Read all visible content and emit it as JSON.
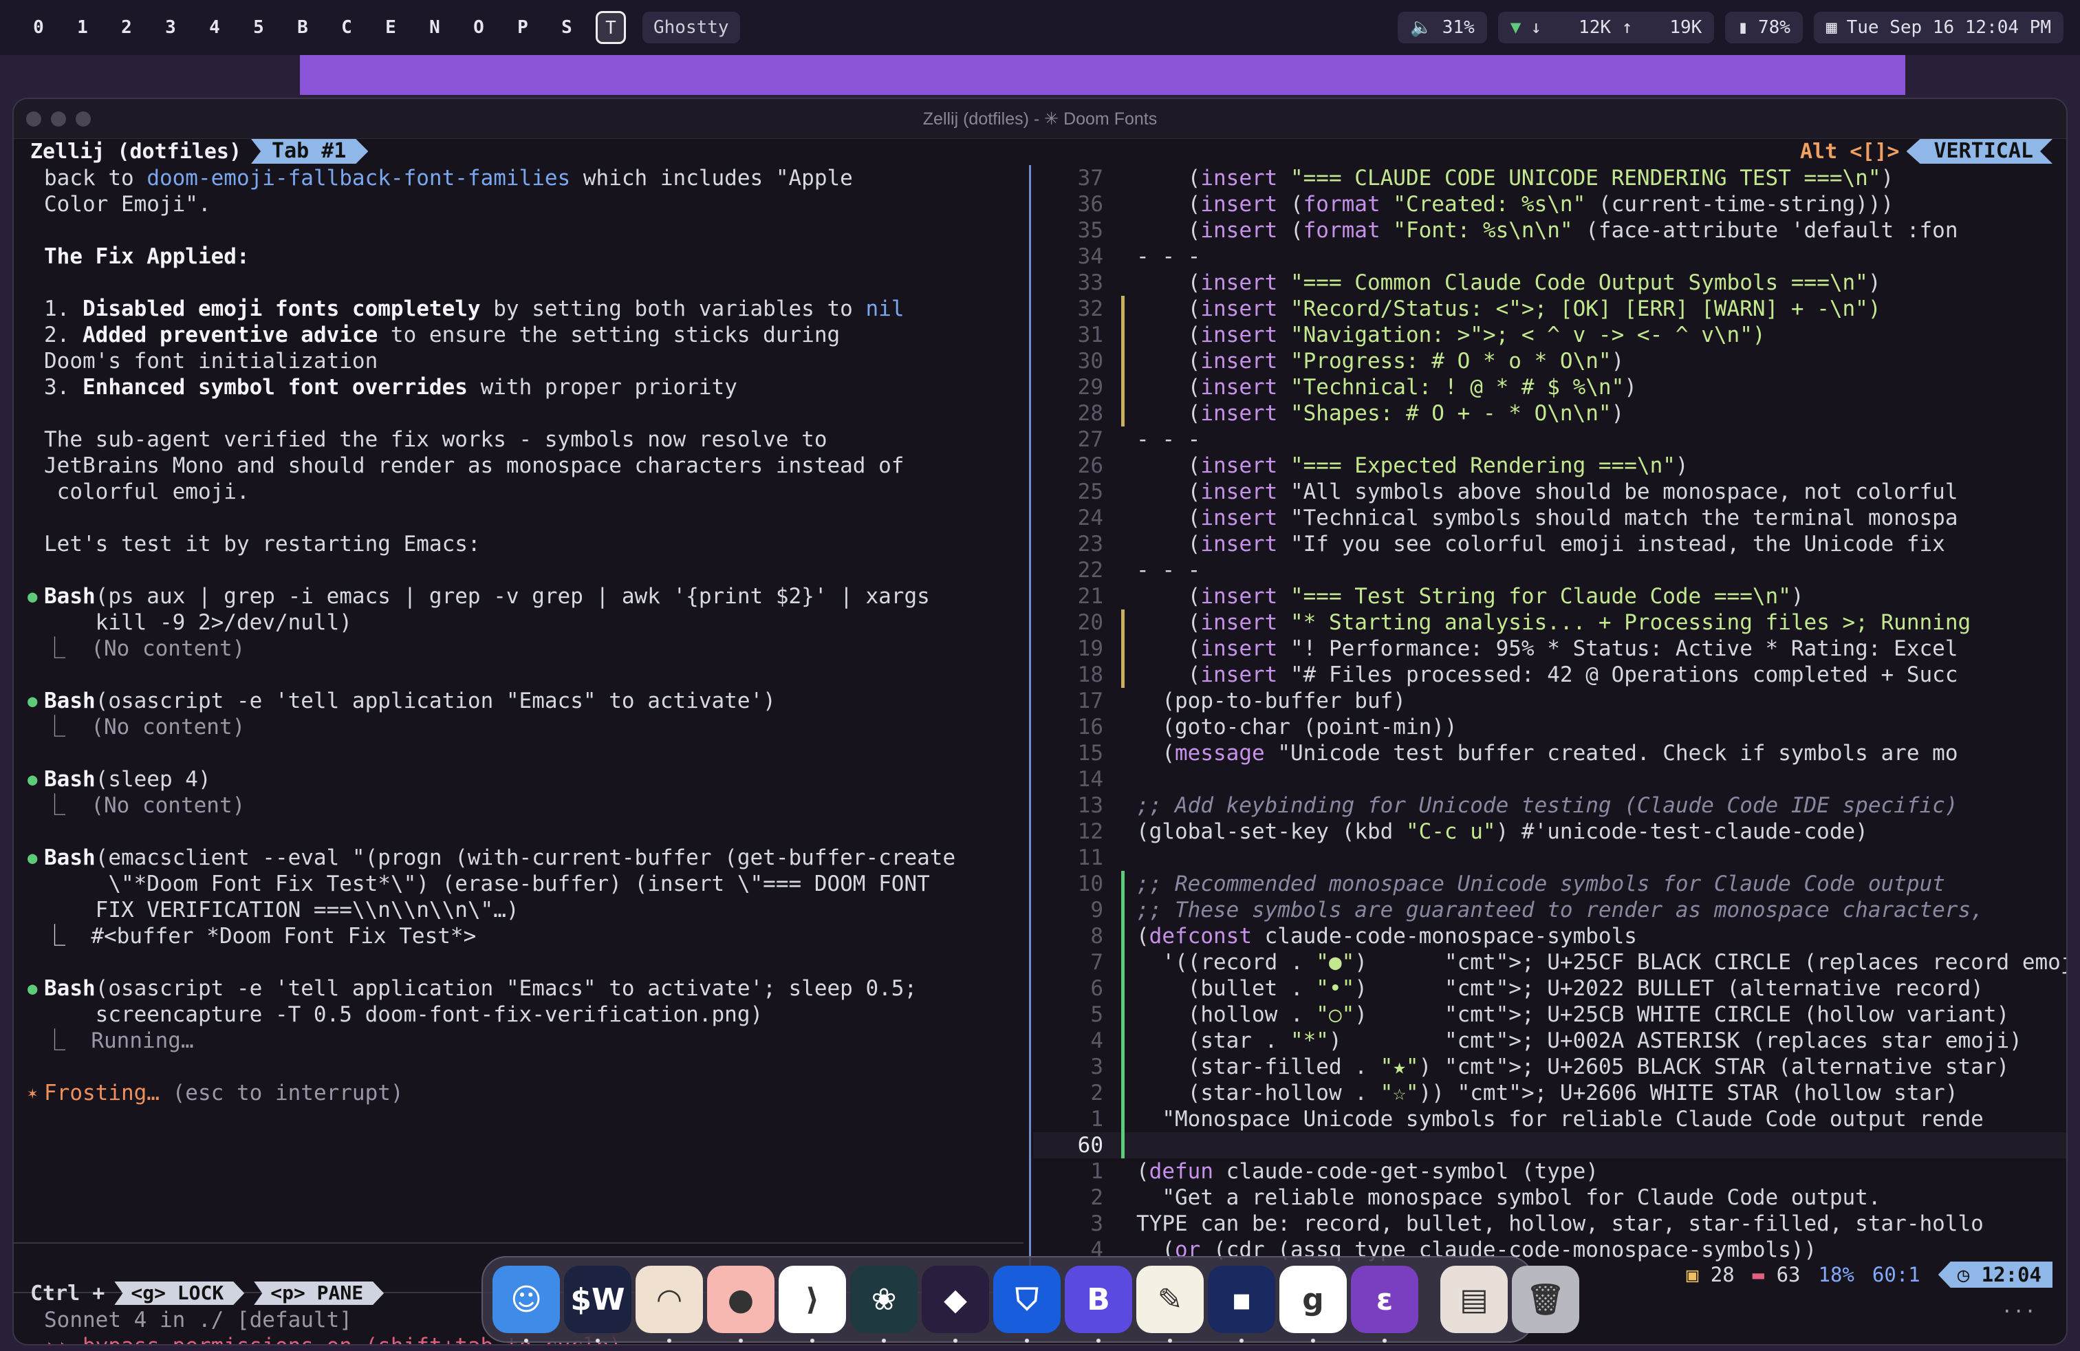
{
  "topbar": {
    "workspaces": [
      "0",
      "1",
      "2",
      "3",
      "4",
      "5",
      "B",
      "C",
      "E",
      "N",
      "O",
      "P",
      "S"
    ],
    "active_workspace": "T",
    "app": "Ghostty",
    "volume": "31%",
    "down_arrow": "↓",
    "down_speed": "12K ↑",
    "up_speed": "19K",
    "battery": "78%",
    "datetime": "Tue Sep 16 12:04 PM"
  },
  "window": {
    "title": "Zellij (dotfiles) - ✳ Doom Fonts"
  },
  "zellij": {
    "session": "Zellij (dotfiles)",
    "tab": "Tab #1",
    "mode_hint": "Alt <[]>",
    "layout": "VERTICAL",
    "bottom_prefix": "Ctrl +",
    "bottom_keys": [
      "<g> LOCK",
      "<p> PANE"
    ]
  },
  "left_pane": {
    "lines": [
      {
        "t": "back to ",
        "h": "doom-emoji-fallback-font-families",
        "r": " which includes \"Apple"
      },
      {
        "t": "Color Emoji\"."
      },
      {
        "t": ""
      },
      {
        "b": "The Fix Applied:"
      },
      {
        "t": ""
      },
      {
        "t": "1. ",
        "b2": "Disabled emoji fonts completely",
        "r": " by setting both variables to ",
        "h2": "nil"
      },
      {
        "t": "2. ",
        "b2": "Added preventive advice",
        "r": " to ensure the setting sticks during"
      },
      {
        "t": "Doom's font initialization"
      },
      {
        "t": "3. ",
        "b2": "Enhanced symbol font overrides",
        "r": " with proper priority"
      },
      {
        "t": ""
      },
      {
        "t": "The sub-agent verified the fix works - symbols now resolve to"
      },
      {
        "t": "JetBrains Mono and should render as monospace characters instead of"
      },
      {
        "t": " colorful emoji."
      },
      {
        "t": ""
      },
      {
        "t": "Let's test it by restarting Emacs:"
      },
      {
        "t": ""
      },
      {
        "bullet": "●",
        "b2": "Bash",
        "r": "(ps aux | grep -i emacs | grep -v grep | awk '{print $2}' | xargs"
      },
      {
        "t": "    kill -9 2>/dev/null)"
      },
      {
        "d": "⎿  (No content)"
      },
      {
        "t": ""
      },
      {
        "bullet": "●",
        "b2": "Bash",
        "r": "(osascript -e 'tell application \"Emacs\" to activate')"
      },
      {
        "d": "⎿  (No content)"
      },
      {
        "t": ""
      },
      {
        "bullet": "●",
        "b2": "Bash",
        "r": "(sleep 4)"
      },
      {
        "d": "⎿  (No content)"
      },
      {
        "t": ""
      },
      {
        "bullet": "●",
        "b2": "Bash",
        "r": "(emacsclient --eval \"(progn (with-current-buffer (get-buffer-create"
      },
      {
        "t": "     \\\"*Doom Font Fix Test*\\\") (erase-buffer) (insert \\\"=== DOOM FONT"
      },
      {
        "t": "    FIX VERIFICATION ===\\\\n\\\\n\\\\n\\\"…)"
      },
      {
        "t": "⎿  #<buffer *Doom Font Fix Test*>"
      },
      {
        "t": ""
      },
      {
        "bullet": "●",
        "b2": "Bash",
        "r": "(osascript -e 'tell application \"Emacs\" to activate'; sleep 0.5;"
      },
      {
        "t": "    screencapture -T 0.5 doom-font-fix-verification.png)"
      },
      {
        "d": "⎿  Running…"
      },
      {
        "t": ""
      },
      {
        "o": "Frosting… ",
        "d2": "(esc to interrupt)"
      }
    ],
    "prompt_symbol": ">",
    "model_line": "Sonnet 4 in ./ [default]",
    "permissions_line": "›› bypass permissions on (shift+tab to cycle)"
  },
  "right_pane": {
    "lines": [
      {
        "n": "37",
        "c": "    (insert \"=== CLAUDE CODE UNICODE RENDERING TEST ===\\n\")"
      },
      {
        "n": "36",
        "c": "    (insert (format \"Created: %s\\n\" (current-time-string)))"
      },
      {
        "n": "35",
        "c": "    (insert (format \"Font: %s\\n\\n\" (face-attribute 'default :fon"
      },
      {
        "n": "34",
        "c": "- - -"
      },
      {
        "n": "33",
        "c": "    (insert \"=== Common Claude Code Output Symbols ===\\n\")"
      },
      {
        "n": "32",
        "c": "    (insert \"Record/Status: < [OK] [ERR] [WARN] + -\\n\")",
        "m": "y"
      },
      {
        "n": "31",
        "c": "    (insert \"Navigation: > < ^ v -> <- ^ v\\n\")",
        "m": "y"
      },
      {
        "n": "30",
        "c": "    (insert \"Progress: # O * o * O\\n\")",
        "m": "y"
      },
      {
        "n": "29",
        "c": "    (insert \"Technical: ! @ * # $ %\\n\")",
        "m": "y"
      },
      {
        "n": "28",
        "c": "    (insert \"Shapes: # O + - * O\\n\\n\")",
        "m": "y"
      },
      {
        "n": "27",
        "c": "- - -"
      },
      {
        "n": "26",
        "c": "    (insert \"=== Expected Rendering ===\\n\")"
      },
      {
        "n": "25",
        "c": "    (insert \"All symbols above should be monospace, not colorful"
      },
      {
        "n": "24",
        "c": "    (insert \"Technical symbols should match the terminal monospa"
      },
      {
        "n": "23",
        "c": "    (insert \"If you see colorful emoji instead, the Unicode fix"
      },
      {
        "n": "22",
        "c": "- - -"
      },
      {
        "n": "21",
        "c": "    (insert \"=== Test String for Claude Code ===\\n\")"
      },
      {
        "n": "20",
        "c": "    (insert \"* Starting analysis... + Processing files > Running",
        "m": "y"
      },
      {
        "n": "19",
        "c": "    (insert \"! Performance: 95% * Status: Active * Rating: Excel",
        "m": "y"
      },
      {
        "n": "18",
        "c": "    (insert \"# Files processed: 42 @ Operations completed + Succ",
        "m": "y"
      },
      {
        "n": "17",
        "c": "  (pop-to-buffer buf)"
      },
      {
        "n": "16",
        "c": "  (goto-char (point-min))"
      },
      {
        "n": "15",
        "c": "  (message \"Unicode test buffer created. Check if symbols are mo"
      },
      {
        "n": "14",
        "c": ""
      },
      {
        "n": "13",
        "c": ";; Add keybinding for Unicode testing (Claude Code IDE specific)",
        "k": "cmt"
      },
      {
        "n": "12",
        "c": "(global-set-key (kbd \"C-c u\") #'unicode-test-claude-code)"
      },
      {
        "n": "11",
        "c": ""
      },
      {
        "n": "10",
        "c": ";; Recommended monospace Unicode symbols for Claude Code output",
        "k": "cmt",
        "m": "g"
      },
      {
        "n": "9",
        "c": ";; These symbols are guaranteed to render as monospace characters,",
        "k": "cmt",
        "m": "g"
      },
      {
        "n": "8",
        "c": "(defconst claude-code-monospace-symbols",
        "m": "g"
      },
      {
        "n": "7",
        "c": "  '((record . \"●\")      ; U+25CF BLACK CIRCLE (replaces record emoj",
        "m": "g"
      },
      {
        "n": "6",
        "c": "    (bullet . \"•\")      ; U+2022 BULLET (alternative record)",
        "m": "g"
      },
      {
        "n": "5",
        "c": "    (hollow . \"○\")      ; U+25CB WHITE CIRCLE (hollow variant)",
        "m": "g"
      },
      {
        "n": "4",
        "c": "    (star . \"*\")        ; U+002A ASTERISK (replaces star emoji)",
        "m": "g"
      },
      {
        "n": "3",
        "c": "    (star-filled . \"★\") ; U+2605 BLACK STAR (alternative star)",
        "m": "g"
      },
      {
        "n": "2",
        "c": "    (star-hollow . \"☆\")) ; U+2606 WHITE STAR (hollow star)",
        "m": "g"
      },
      {
        "n": "1",
        "c": "  \"Monospace Unicode symbols for reliable Claude Code output rende",
        "m": "g"
      },
      {
        "n": "60",
        "c": "",
        "cur": true,
        "m": "g"
      },
      {
        "n": "1",
        "c": "(defun claude-code-get-symbol (type)"
      },
      {
        "n": "2",
        "c": "  \"Get a reliable monospace symbol for Claude Code output."
      },
      {
        "n": "3",
        "c": "TYPE can be: record, bullet, hollow, star, star-filled, star-hollo"
      },
      {
        "n": "4",
        "c": "  (or (cdr (assq type claude-code-monospace-symbols))"
      }
    ]
  },
  "modeline": {
    "warnings": "28",
    "errors": "63",
    "percent": "18%",
    "position": "60:1",
    "clock": "12:04",
    "ellipsis": "..."
  },
  "dock": {
    "apps": [
      {
        "name": "finder-icon",
        "glyph": "☺",
        "bg": "#3f8be8",
        "running": true
      },
      {
        "name": "warp-icon",
        "glyph": "$W",
        "bg": "#1c2340",
        "running": true
      },
      {
        "name": "arc-icon",
        "glyph": "◠",
        "bg": "#f0e0d0",
        "running": true
      },
      {
        "name": "app-circle-icon",
        "glyph": "●",
        "bg": "#f6b8b0",
        "running": true
      },
      {
        "name": "vscode-icon",
        "glyph": "⟩",
        "bg": "#ffffff",
        "running": true
      },
      {
        "name": "app-paw-icon",
        "glyph": "❀",
        "bg": "#1e3a40",
        "running": true
      },
      {
        "name": "obsidian-icon",
        "glyph": "◆",
        "bg": "#2a1e3e",
        "running": true
      },
      {
        "name": "bitwarden-icon",
        "glyph": "⛉",
        "bg": "#175ddc",
        "running": true
      },
      {
        "name": "app-b-icon",
        "glyph": "B",
        "bg": "#5a4ae0",
        "running": true
      },
      {
        "name": "app-sheet-icon",
        "glyph": "✎",
        "bg": "#f4f0e4",
        "running": true
      },
      {
        "name": "app-terminal-icon",
        "glyph": "▪",
        "bg": "#1a2a60",
        "running": true
      },
      {
        "name": "app-g-icon",
        "glyph": "g",
        "bg": "#ffffff",
        "running": true
      },
      {
        "name": "emacs-icon",
        "glyph": "ε",
        "bg": "#7a3fc0",
        "running": true
      },
      {
        "name": "downloads-icon",
        "glyph": "▤",
        "bg": "#e8e0d8",
        "running": false
      },
      {
        "name": "trash-icon",
        "glyph": "🗑",
        "bg": "#b8b8c0",
        "running": false
      }
    ]
  }
}
